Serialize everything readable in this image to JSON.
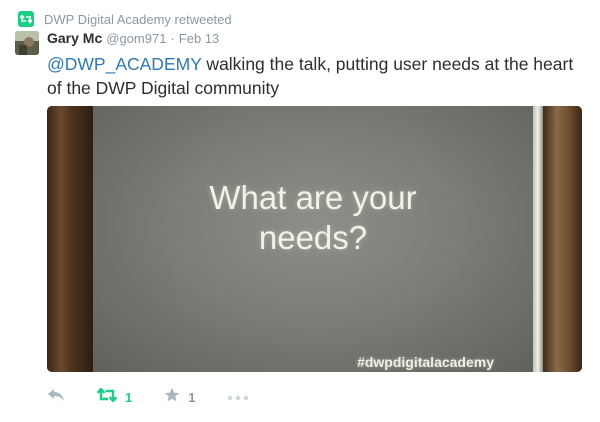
{
  "retweet_context": {
    "text": "DWP Digital Academy retweeted",
    "icon": "retweet-context-icon"
  },
  "tweet": {
    "author_name": "Gary Mc",
    "author_handle": "@gom971",
    "separator": "·",
    "date": "Feb 13",
    "mention": "@DWP_ACADEMY",
    "text_rest": " walking the talk, putting user needs at the heart of the DWP Digital community",
    "media": {
      "slide_text_line1": "What are your",
      "slide_text_line2": "needs?",
      "hashtag": "#dwpdigitalacademy"
    }
  },
  "actions": {
    "reply_icon": "reply-icon",
    "retweet_icon": "retweet-icon",
    "retweet_count": "1",
    "favorite_icon": "star-icon",
    "favorite_count": "1",
    "more_icon": "more-icon"
  },
  "colors": {
    "retweet_green": "#19cf86",
    "link_blue": "#2b7bb9",
    "muted_gray": "#8899a6",
    "text_dark": "#292f33",
    "action_gray": "#aab8c2"
  }
}
